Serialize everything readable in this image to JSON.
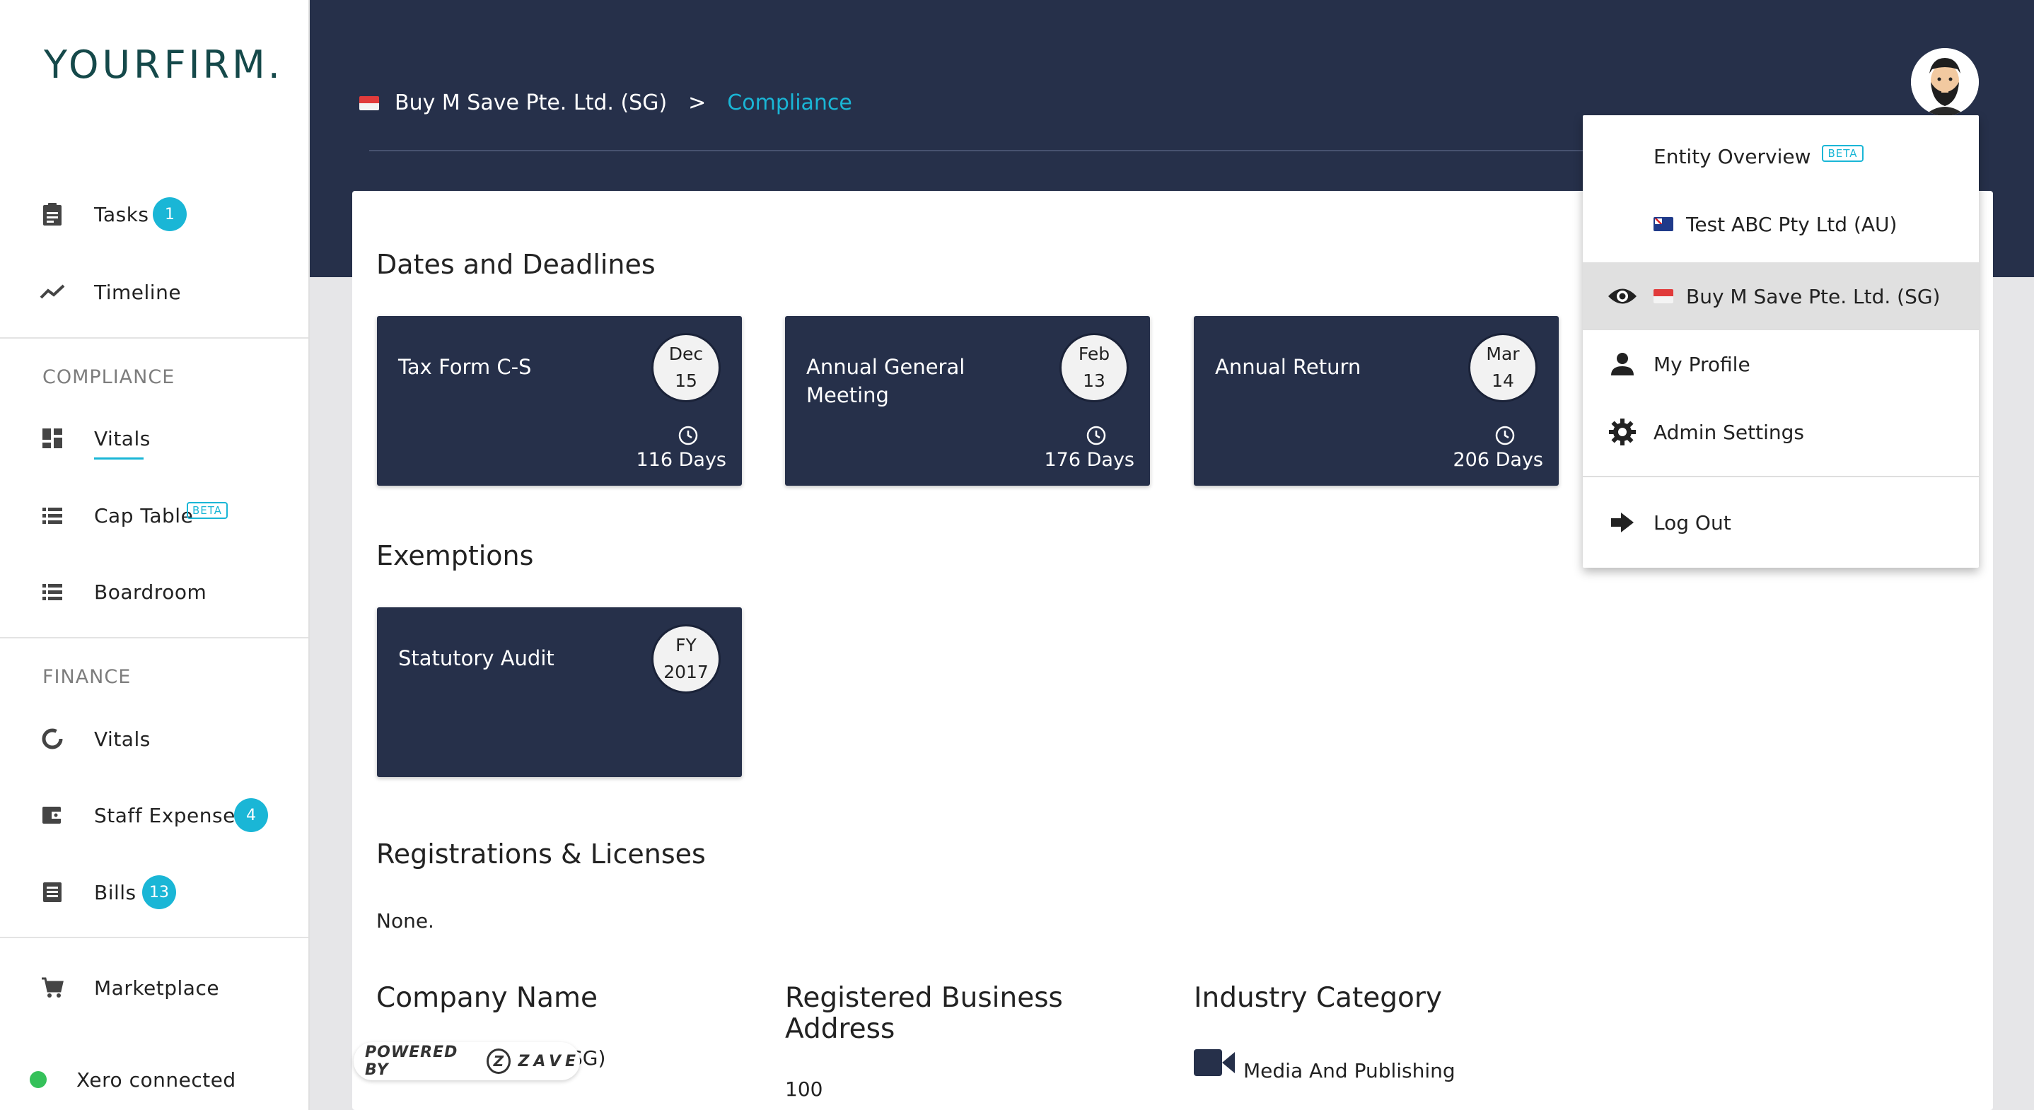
{
  "logo": {
    "bold": "YOUR",
    "light": "FIRM",
    "dot": "."
  },
  "sidebar": {
    "tasks": {
      "label": "Tasks",
      "badge": "1"
    },
    "timeline": {
      "label": "Timeline"
    },
    "compliance_header": "COMPLIANCE",
    "compliance_vitals": {
      "label": "Vitals"
    },
    "cap_table": {
      "label": "Cap Table",
      "badge": "BETA"
    },
    "boardroom": {
      "label": "Boardroom"
    },
    "finance_header": "FINANCE",
    "finance_vitals": {
      "label": "Vitals"
    },
    "staff_expenses": {
      "label": "Staff Expenses",
      "badge": "4"
    },
    "bills": {
      "label": "Bills",
      "badge": "13"
    },
    "marketplace": {
      "label": "Marketplace"
    },
    "xero": {
      "label": "Xero connected",
      "status_color": "#35c15a"
    }
  },
  "breadcrumb": {
    "entity": "Buy M Save Pte. Ltd. (SG)",
    "separator": ">",
    "current": "Compliance"
  },
  "dates": {
    "title": "Dates and Deadlines",
    "tiles": [
      {
        "title": "Tax Form C-S",
        "month": "Dec",
        "day": "15",
        "days": "116 Days"
      },
      {
        "title": "Annual General Meeting",
        "month": "Feb",
        "day": "13",
        "days": "176 Days"
      },
      {
        "title": "Annual Return",
        "month": "Mar",
        "day": "14",
        "days": "206 Days"
      }
    ]
  },
  "exemptions": {
    "title": "Exemptions",
    "tiles": [
      {
        "title": "Statutory Audit",
        "line1": "FY",
        "line2": "2017"
      }
    ]
  },
  "registrations": {
    "title": "Registrations & Licenses",
    "value": "None."
  },
  "company_name": {
    "title": "Company Name",
    "value_tail": "SG)"
  },
  "business_address": {
    "title": "Registered Business Address",
    "value": "100"
  },
  "industry": {
    "title": "Industry Category",
    "value": "Media And Publishing",
    "icon": "video-camera-icon"
  },
  "dropdown": {
    "entity_overview": {
      "label": "Entity Overview",
      "badge": "BETA"
    },
    "entity_au": {
      "label": "Test ABC Pty Ltd (AU)"
    },
    "entity_sg": {
      "label": "Buy M Save Pte. Ltd. (SG)"
    },
    "my_profile": {
      "label": "My Profile"
    },
    "admin_settings": {
      "label": "Admin Settings"
    },
    "log_out": {
      "label": "Log Out"
    }
  },
  "powered_by": {
    "prefix": "POWERED BY",
    "brand": "ZAVE",
    "logo_letter": "Z"
  },
  "colors": {
    "navy": "#26304a",
    "accent": "#1ab6d6",
    "logo": "#15494a"
  }
}
